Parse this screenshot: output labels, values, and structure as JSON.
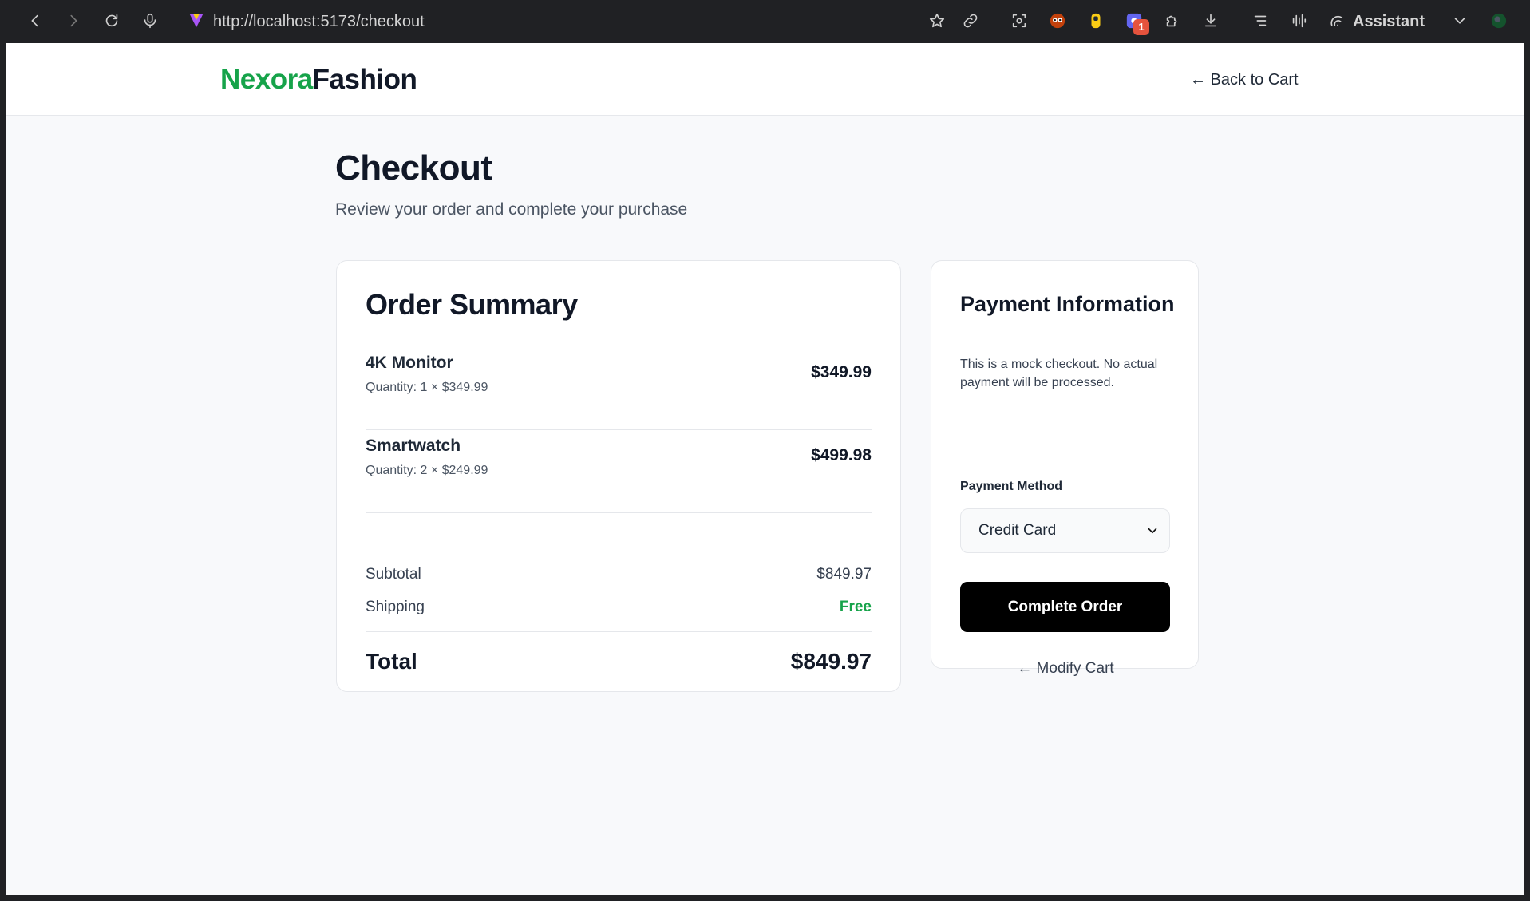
{
  "browser": {
    "url": "http://localhost:5173/checkout",
    "assistant_label": "Assistant",
    "extension_badge": "1",
    "icons": [
      "back-icon",
      "forward-icon",
      "reload-icon",
      "mic-icon",
      "site-icon",
      "star-icon",
      "link-icon",
      "screenshot-icon",
      "extension-icon",
      "extension-icon",
      "extension-icon",
      "puzzle-icon",
      "download-icon",
      "reading-list-icon",
      "audio-icon",
      "assistant-icon",
      "chevron-down-icon",
      "profile-icon"
    ]
  },
  "header": {
    "logo_part1": "Nexora",
    "logo_part2": "Fashion",
    "back_to_cart": "← Back to Cart"
  },
  "page": {
    "title": "Checkout",
    "subtitle": "Review your order and complete your purchase"
  },
  "order": {
    "heading": "Order Summary",
    "items": [
      {
        "name": "4K Monitor",
        "quantity_text": "Quantity: 1 × $349.99",
        "price": "$349.99"
      },
      {
        "name": "Smartwatch",
        "quantity_text": "Quantity: 2 × $249.99",
        "price": "$499.98"
      }
    ],
    "subtotal_label": "Subtotal",
    "subtotal_value": "$849.97",
    "shipping_label": "Shipping",
    "shipping_value": "Free",
    "total_label": "Total",
    "total_value": "$849.97"
  },
  "payment": {
    "heading": "Payment Information",
    "note": "This is a mock checkout. No actual payment will be processed.",
    "method_label": "Payment Method",
    "method_value": "Credit Card",
    "complete_button": "Complete Order",
    "modify_cart": "← Modify Cart"
  },
  "colors": {
    "brand_green": "#16a34a",
    "text_dark": "#111827",
    "button_black": "#000000",
    "page_bg": "#f8f9fb"
  }
}
